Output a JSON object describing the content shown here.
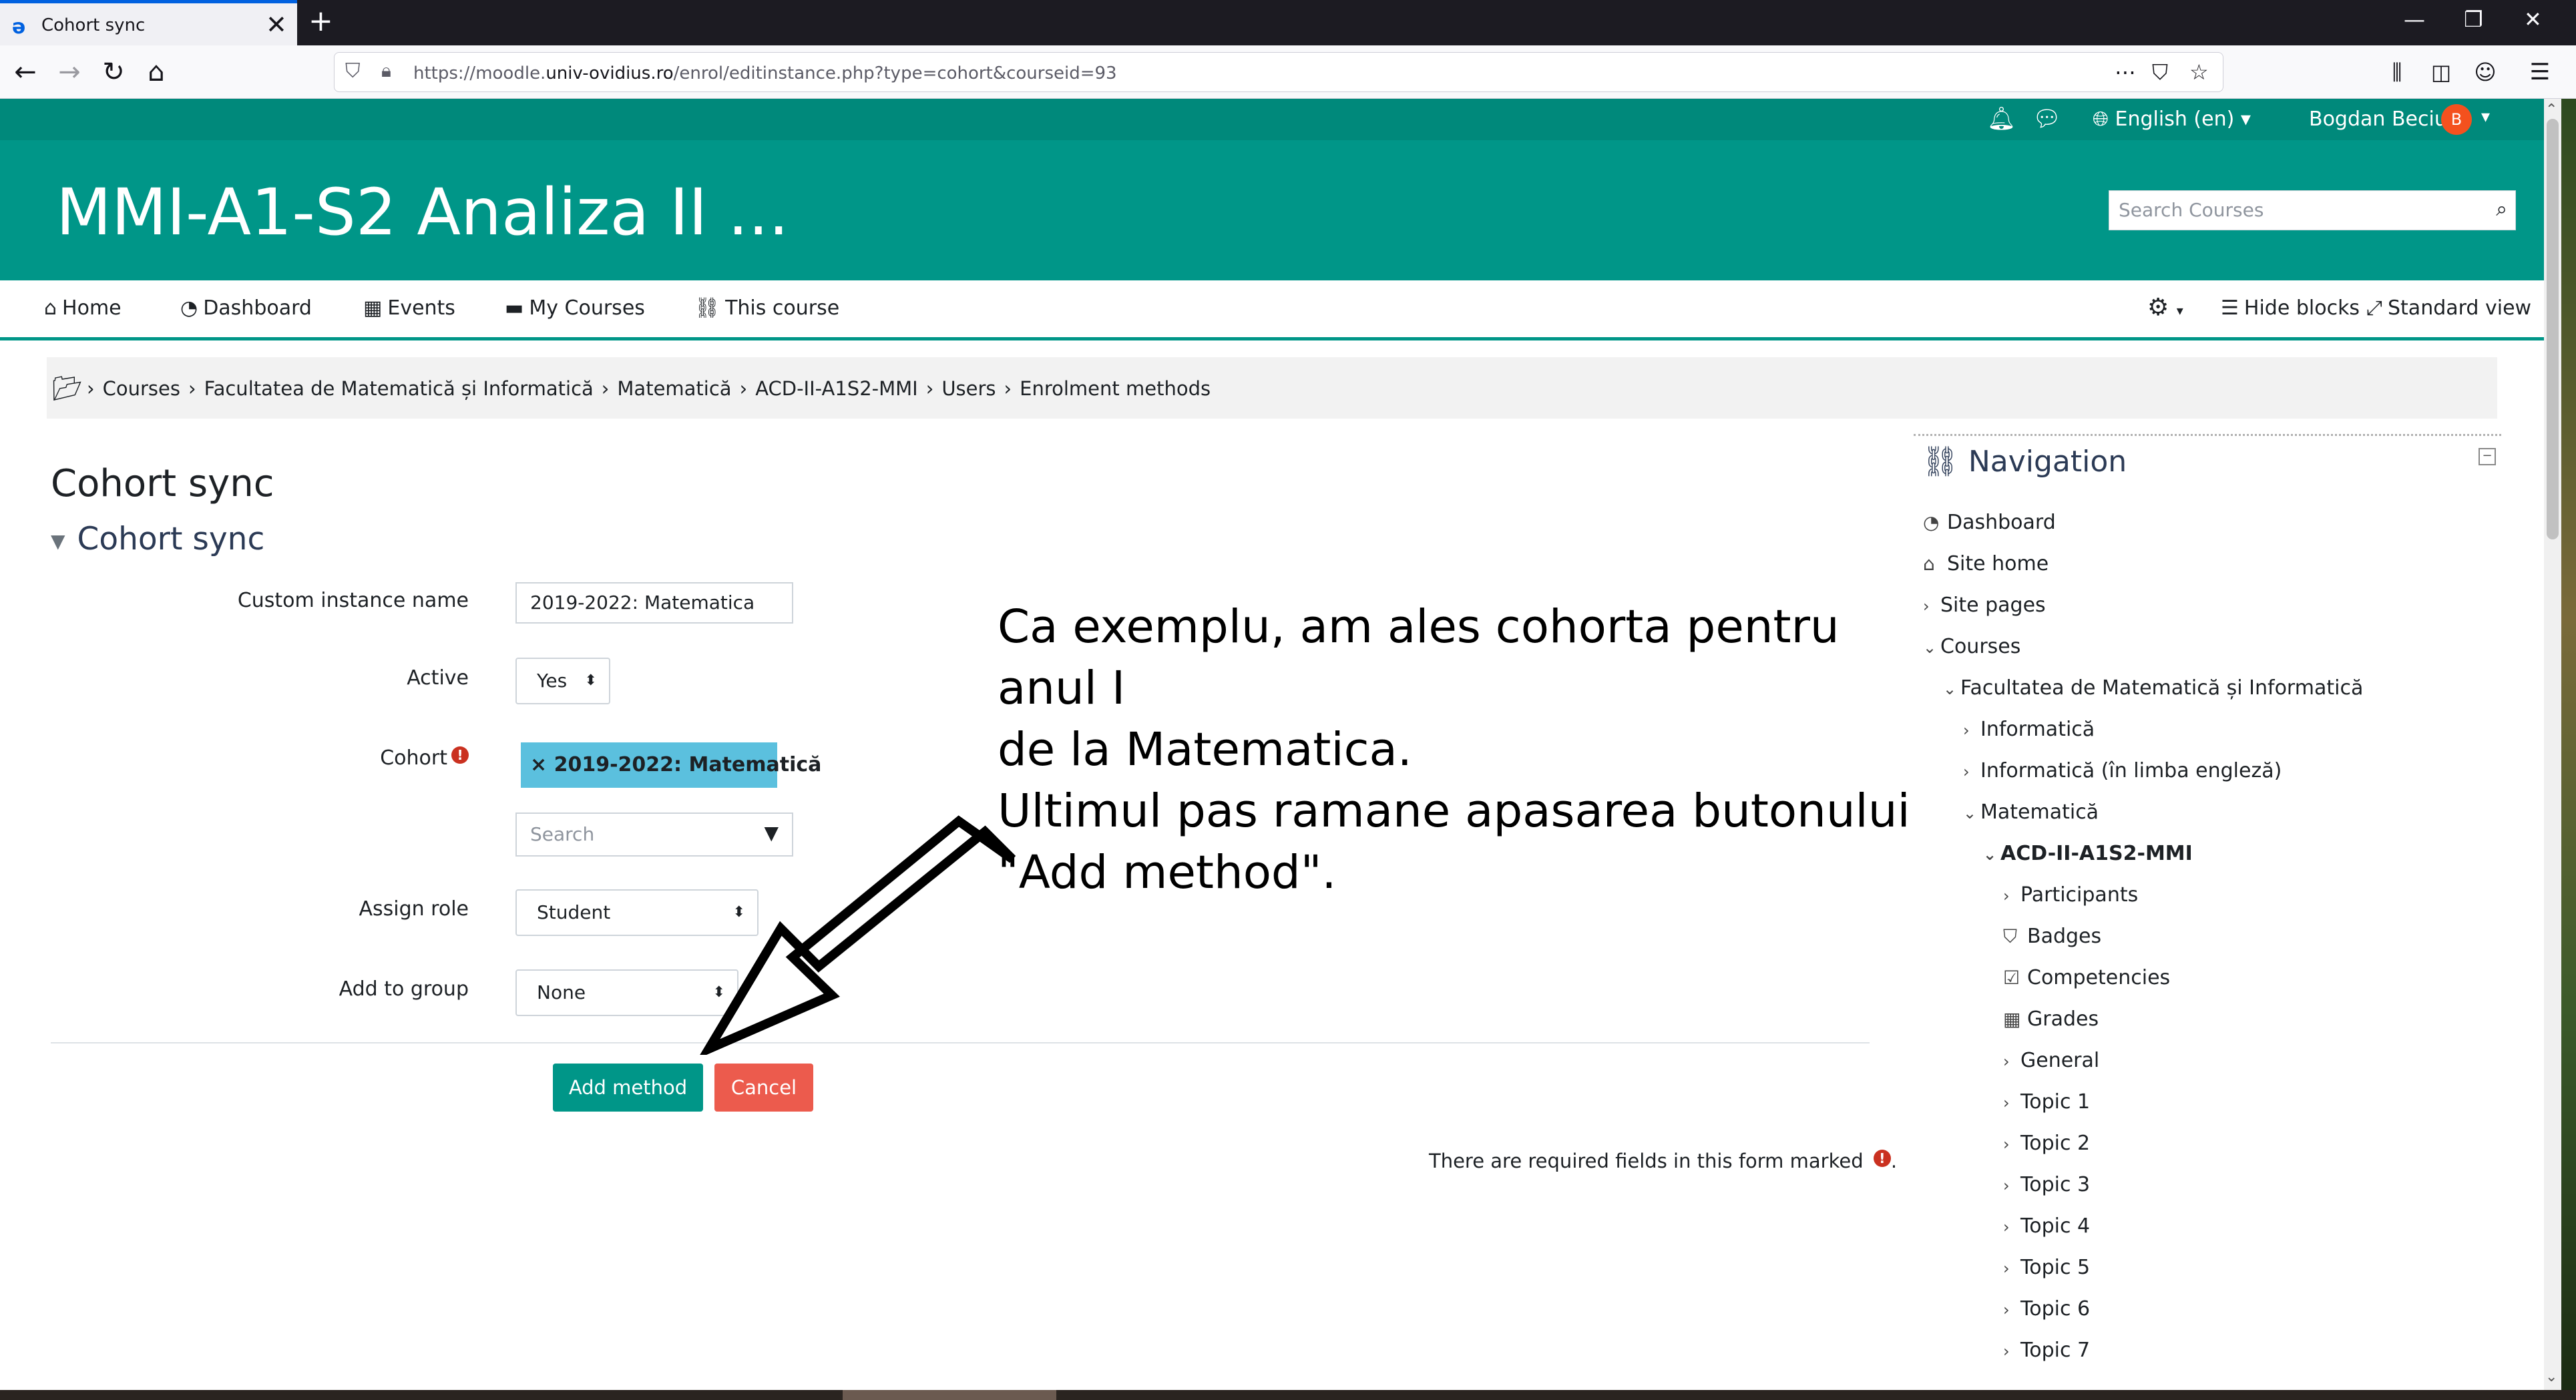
{
  "browser": {
    "tab_title": "Cohort sync",
    "tab_close": "✕",
    "new_tab": "+",
    "url_prefix": "https://moodle.",
    "url_domain": "univ-ovidius.ro",
    "url_path": "/enrol/editinstance.php?type=cohort&courseid=93",
    "window_controls": [
      "—",
      "❐",
      "✕"
    ]
  },
  "topbar": {
    "language": "English (en) ▾",
    "user_name": "Bogdan Beciu",
    "avatar_initial": "B"
  },
  "header": {
    "course_title": "MMI-A1-S2 Analiza II ...",
    "search_placeholder": "Search Courses"
  },
  "course_nav": {
    "items": [
      "Home",
      "Dashboard",
      "Events",
      "My Courses",
      "This course"
    ],
    "hide_blocks": "Hide blocks",
    "standard_view": "Standard view"
  },
  "breadcrumb": [
    "Courses",
    "Facultatea de Matematică și Informatică",
    "Matematică",
    "ACD-II-A1S2-MMI",
    "Users",
    "Enrolment methods"
  ],
  "form": {
    "page_heading": "Cohort sync",
    "section_heading": "Cohort sync",
    "custom_name_label": "Custom instance name",
    "custom_name_value": "2019-2022: Matematica",
    "active_label": "Active",
    "active_value": "Yes",
    "cohort_label": "Cohort",
    "cohort_selected": "× 2019-2022: Matematică",
    "cohort_search_placeholder": "Search",
    "assign_role_label": "Assign role",
    "assign_role_value": "Student",
    "add_group_label": "Add to group",
    "add_group_value": "None",
    "add_button": "Add method",
    "cancel_button": "Cancel",
    "required_note": "There are required fields in this form marked",
    "required_mark": "!"
  },
  "annotation": {
    "line1": "Ca exemplu, am ales cohorta pentru anul I",
    "line2": "de la Matematica.",
    "line3": "Ultimul pas ramane apasarea butonului",
    "line4": "\"Add method\"."
  },
  "navigation": {
    "title": "Navigation",
    "items": [
      {
        "label": "Dashboard",
        "icon": "dashboard-icon"
      },
      {
        "label": "Site home",
        "icon": "home-icon"
      },
      {
        "label": "Site pages",
        "icon": "chevron-right-icon"
      },
      {
        "label": "Courses",
        "icon": "chevron-down-icon"
      },
      {
        "label": "Facultatea de Matematică și Informatică",
        "icon": "chevron-down-icon"
      },
      {
        "label": "Informatică",
        "icon": "chevron-right-icon"
      },
      {
        "label": "Informatică (în limba engleză)",
        "icon": "chevron-right-icon"
      },
      {
        "label": "Matematică",
        "icon": "chevron-down-icon"
      },
      {
        "label": "ACD-II-A1S2-MMI",
        "icon": "chevron-down-icon"
      },
      {
        "label": "Participants",
        "icon": "chevron-right-icon"
      },
      {
        "label": "Badges",
        "icon": "badge-icon"
      },
      {
        "label": "Competencies",
        "icon": "checkbox-icon"
      },
      {
        "label": "Grades",
        "icon": "table-icon"
      },
      {
        "label": "General",
        "icon": "chevron-right-icon"
      },
      {
        "label": "Topic 1",
        "icon": "chevron-right-icon"
      },
      {
        "label": "Topic 2",
        "icon": "chevron-right-icon"
      },
      {
        "label": "Topic 3",
        "icon": "chevron-right-icon"
      },
      {
        "label": "Topic 4",
        "icon": "chevron-right-icon"
      },
      {
        "label": "Topic 5",
        "icon": "chevron-right-icon"
      },
      {
        "label": "Topic 6",
        "icon": "chevron-right-icon"
      },
      {
        "label": "Topic 7",
        "icon": "chevron-right-icon"
      }
    ]
  },
  "colors": {
    "brand": "#009688",
    "brand_dark": "#00897b",
    "cancel": "#ec5b4d",
    "cohort_tag": "#5bc0de",
    "required": "#ca3120"
  }
}
